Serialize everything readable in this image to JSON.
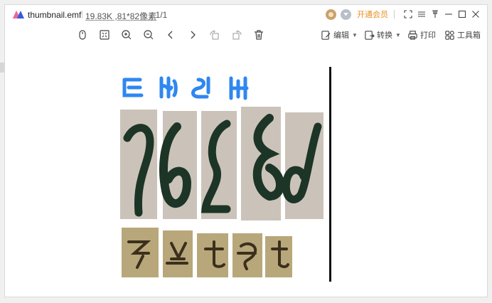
{
  "titlebar": {
    "filename": "thumbnail.emf",
    "file_info": "19.83K ,81*82像素",
    "page_info": ", 1/1",
    "vip_label": "开通会员"
  },
  "toolbar": {
    "edit_label": "编辑",
    "convert_label": "转换",
    "print_label": "打印",
    "toolbox_label": "工具箱"
  },
  "colors": {
    "accent": "#e8901e",
    "logo": "#3b5bdb",
    "glyph_blue": "#2f87f0",
    "glyph_dark": "#1d3526"
  }
}
